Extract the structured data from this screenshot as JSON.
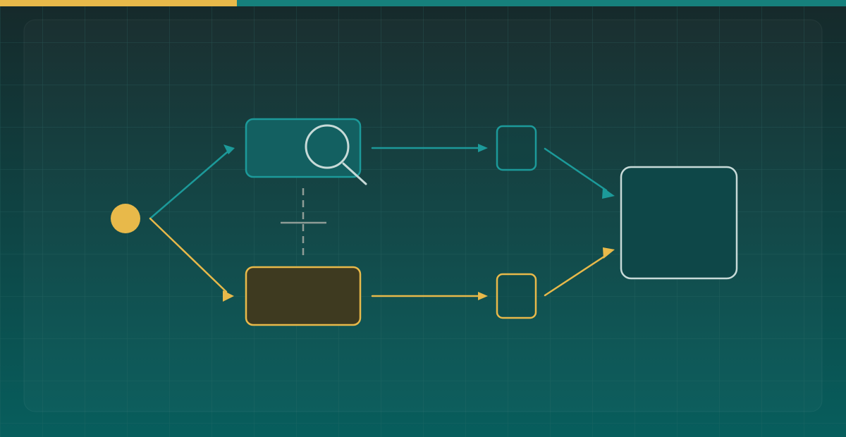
{
  "colors": {
    "background_top": "#16292a",
    "background_bottom": "#075e5d",
    "gold": "#e8b94a",
    "teal": "#1c9a9a",
    "teal_fill": "#136061",
    "gold_fill": "#3e3a20",
    "silver": "#c7dad8",
    "output_fill": "#0e4748",
    "grid": "#2f6e6b",
    "junction": "#8e9c96"
  },
  "progress_bar": {
    "fraction": 0.28
  },
  "nodes": [
    {
      "id": "start",
      "kind": "circle"
    },
    {
      "id": "search-stage",
      "kind": "rounded-rect",
      "icon": "magnifier-icon"
    },
    {
      "id": "hold-stage",
      "kind": "rounded-rect"
    },
    {
      "id": "upper-checkpoint",
      "kind": "rounded-rect"
    },
    {
      "id": "lower-checkpoint",
      "kind": "rounded-rect"
    },
    {
      "id": "merge-output",
      "kind": "rounded-rect"
    }
  ],
  "edges": [
    {
      "from": "start",
      "to": "search-stage",
      "color": "teal",
      "arrow": true
    },
    {
      "from": "start",
      "to": "hold-stage",
      "color": "gold",
      "arrow": true
    },
    {
      "from": "search-stage",
      "to": "upper-checkpoint",
      "color": "teal",
      "arrow": true
    },
    {
      "from": "hold-stage",
      "to": "lower-checkpoint",
      "color": "gold",
      "arrow": true
    },
    {
      "from": "upper-checkpoint",
      "to": "merge-output",
      "color": "teal",
      "arrow": true
    },
    {
      "from": "lower-checkpoint",
      "to": "merge-output",
      "color": "gold",
      "arrow": true
    },
    {
      "from": "search-stage",
      "to": "hold-stage",
      "color": "junction",
      "style": "dashed",
      "arrow": false
    }
  ]
}
